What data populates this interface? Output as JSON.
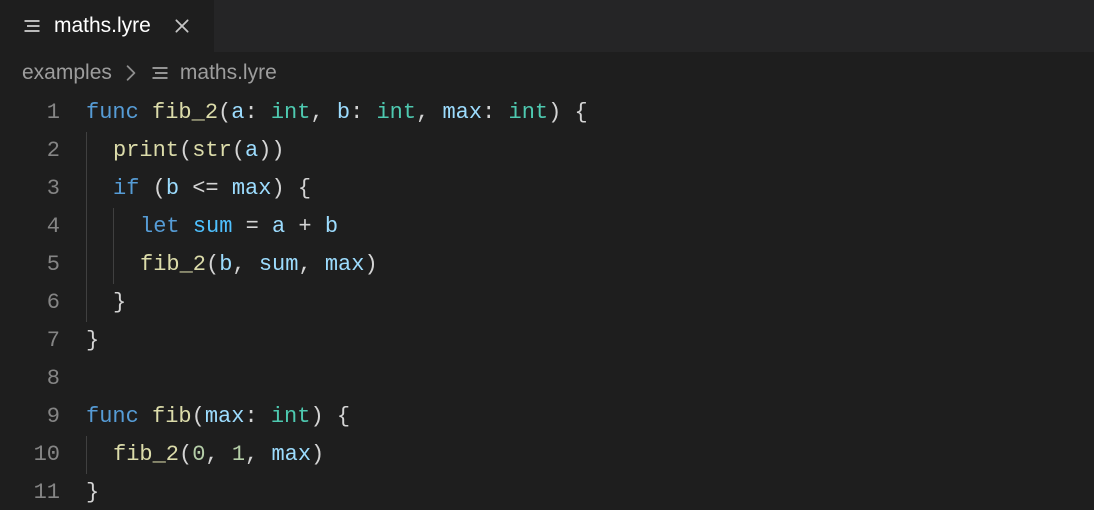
{
  "tab": {
    "filename": "maths.lyre",
    "iconName": "file-icon",
    "closeName": "close-icon"
  },
  "breadcrumb": {
    "folder": "examples",
    "filename": "maths.lyre",
    "iconName": "file-icon"
  },
  "colors": {
    "background": "#1e1e1e",
    "tabbar": "#252526",
    "text": "#d4d4d4",
    "gutter": "#858585",
    "keyword": "#569cd6",
    "function": "#dcdcaa",
    "param": "#9cdcfe",
    "type": "#4ec9b0",
    "number": "#b5cea8",
    "indentGuide": "#404040"
  },
  "lines": [
    {
      "num": 1,
      "guides": 0,
      "tokens": [
        {
          "cls": "tok-kw",
          "t": "func"
        },
        {
          "cls": "tok-plain",
          "t": " "
        },
        {
          "cls": "tok-fn",
          "t": "fib_2"
        },
        {
          "cls": "tok-punct",
          "t": "("
        },
        {
          "cls": "tok-param",
          "t": "a"
        },
        {
          "cls": "tok-punct",
          "t": ": "
        },
        {
          "cls": "tok-type",
          "t": "int"
        },
        {
          "cls": "tok-punct",
          "t": ", "
        },
        {
          "cls": "tok-param",
          "t": "b"
        },
        {
          "cls": "tok-punct",
          "t": ": "
        },
        {
          "cls": "tok-type",
          "t": "int"
        },
        {
          "cls": "tok-punct",
          "t": ", "
        },
        {
          "cls": "tok-param",
          "t": "max"
        },
        {
          "cls": "tok-punct",
          "t": ": "
        },
        {
          "cls": "tok-type",
          "t": "int"
        },
        {
          "cls": "tok-punct",
          "t": ") {"
        }
      ]
    },
    {
      "num": 2,
      "guides": 1,
      "tokens": [
        {
          "cls": "tok-fn",
          "t": "print"
        },
        {
          "cls": "tok-punct",
          "t": "("
        },
        {
          "cls": "tok-fn",
          "t": "str"
        },
        {
          "cls": "tok-punct",
          "t": "("
        },
        {
          "cls": "tok-var",
          "t": "a"
        },
        {
          "cls": "tok-punct",
          "t": "))"
        }
      ]
    },
    {
      "num": 3,
      "guides": 1,
      "tokens": [
        {
          "cls": "tok-kw",
          "t": "if"
        },
        {
          "cls": "tok-plain",
          "t": " "
        },
        {
          "cls": "tok-punct",
          "t": "("
        },
        {
          "cls": "tok-var",
          "t": "b"
        },
        {
          "cls": "tok-plain",
          "t": " <= "
        },
        {
          "cls": "tok-var",
          "t": "max"
        },
        {
          "cls": "tok-punct",
          "t": ") {"
        }
      ]
    },
    {
      "num": 4,
      "guides": 2,
      "tokens": [
        {
          "cls": "tok-decl",
          "t": "let"
        },
        {
          "cls": "tok-plain",
          "t": " "
        },
        {
          "cls": "tok-const",
          "t": "sum"
        },
        {
          "cls": "tok-plain",
          "t": " = "
        },
        {
          "cls": "tok-var",
          "t": "a"
        },
        {
          "cls": "tok-plain",
          "t": " + "
        },
        {
          "cls": "tok-var",
          "t": "b"
        }
      ]
    },
    {
      "num": 5,
      "guides": 2,
      "tokens": [
        {
          "cls": "tok-fn",
          "t": "fib_2"
        },
        {
          "cls": "tok-punct",
          "t": "("
        },
        {
          "cls": "tok-var",
          "t": "b"
        },
        {
          "cls": "tok-punct",
          "t": ", "
        },
        {
          "cls": "tok-var",
          "t": "sum"
        },
        {
          "cls": "tok-punct",
          "t": ", "
        },
        {
          "cls": "tok-var",
          "t": "max"
        },
        {
          "cls": "tok-punct",
          "t": ")"
        }
      ]
    },
    {
      "num": 6,
      "guides": 1,
      "tokens": [
        {
          "cls": "tok-punct",
          "t": "}"
        }
      ]
    },
    {
      "num": 7,
      "guides": 0,
      "tokens": [
        {
          "cls": "tok-punct",
          "t": "}"
        }
      ]
    },
    {
      "num": 8,
      "guides": 0,
      "tokens": []
    },
    {
      "num": 9,
      "guides": 0,
      "tokens": [
        {
          "cls": "tok-kw",
          "t": "func"
        },
        {
          "cls": "tok-plain",
          "t": " "
        },
        {
          "cls": "tok-fn",
          "t": "fib"
        },
        {
          "cls": "tok-punct",
          "t": "("
        },
        {
          "cls": "tok-param",
          "t": "max"
        },
        {
          "cls": "tok-punct",
          "t": ": "
        },
        {
          "cls": "tok-type",
          "t": "int"
        },
        {
          "cls": "tok-punct",
          "t": ") {"
        }
      ]
    },
    {
      "num": 10,
      "guides": 1,
      "tokens": [
        {
          "cls": "tok-fn",
          "t": "fib_2"
        },
        {
          "cls": "tok-punct",
          "t": "("
        },
        {
          "cls": "tok-num",
          "t": "0"
        },
        {
          "cls": "tok-punct",
          "t": ", "
        },
        {
          "cls": "tok-num",
          "t": "1"
        },
        {
          "cls": "tok-punct",
          "t": ", "
        },
        {
          "cls": "tok-var",
          "t": "max"
        },
        {
          "cls": "tok-punct",
          "t": ")"
        }
      ]
    },
    {
      "num": 11,
      "guides": 0,
      "tokens": [
        {
          "cls": "tok-punct",
          "t": "}"
        }
      ]
    }
  ]
}
